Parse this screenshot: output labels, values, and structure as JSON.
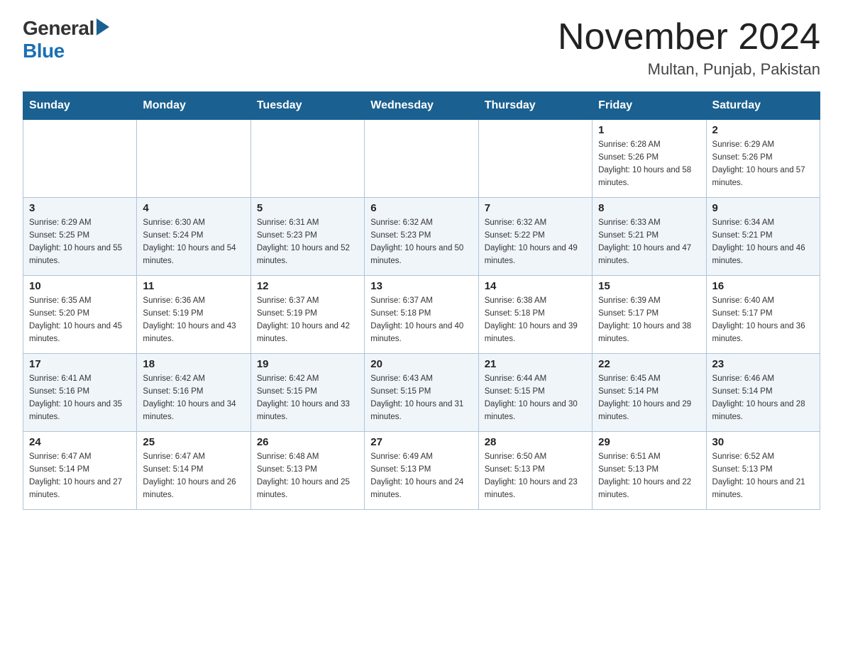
{
  "header": {
    "logo_general": "General",
    "logo_blue": "Blue",
    "month_title": "November 2024",
    "location": "Multan, Punjab, Pakistan"
  },
  "weekdays": [
    "Sunday",
    "Monday",
    "Tuesday",
    "Wednesday",
    "Thursday",
    "Friday",
    "Saturday"
  ],
  "weeks": [
    [
      {
        "day": "",
        "sunrise": "",
        "sunset": "",
        "daylight": ""
      },
      {
        "day": "",
        "sunrise": "",
        "sunset": "",
        "daylight": ""
      },
      {
        "day": "",
        "sunrise": "",
        "sunset": "",
        "daylight": ""
      },
      {
        "day": "",
        "sunrise": "",
        "sunset": "",
        "daylight": ""
      },
      {
        "day": "",
        "sunrise": "",
        "sunset": "",
        "daylight": ""
      },
      {
        "day": "1",
        "sunrise": "Sunrise: 6:28 AM",
        "sunset": "Sunset: 5:26 PM",
        "daylight": "Daylight: 10 hours and 58 minutes."
      },
      {
        "day": "2",
        "sunrise": "Sunrise: 6:29 AM",
        "sunset": "Sunset: 5:26 PM",
        "daylight": "Daylight: 10 hours and 57 minutes."
      }
    ],
    [
      {
        "day": "3",
        "sunrise": "Sunrise: 6:29 AM",
        "sunset": "Sunset: 5:25 PM",
        "daylight": "Daylight: 10 hours and 55 minutes."
      },
      {
        "day": "4",
        "sunrise": "Sunrise: 6:30 AM",
        "sunset": "Sunset: 5:24 PM",
        "daylight": "Daylight: 10 hours and 54 minutes."
      },
      {
        "day": "5",
        "sunrise": "Sunrise: 6:31 AM",
        "sunset": "Sunset: 5:23 PM",
        "daylight": "Daylight: 10 hours and 52 minutes."
      },
      {
        "day": "6",
        "sunrise": "Sunrise: 6:32 AM",
        "sunset": "Sunset: 5:23 PM",
        "daylight": "Daylight: 10 hours and 50 minutes."
      },
      {
        "day": "7",
        "sunrise": "Sunrise: 6:32 AM",
        "sunset": "Sunset: 5:22 PM",
        "daylight": "Daylight: 10 hours and 49 minutes."
      },
      {
        "day": "8",
        "sunrise": "Sunrise: 6:33 AM",
        "sunset": "Sunset: 5:21 PM",
        "daylight": "Daylight: 10 hours and 47 minutes."
      },
      {
        "day": "9",
        "sunrise": "Sunrise: 6:34 AM",
        "sunset": "Sunset: 5:21 PM",
        "daylight": "Daylight: 10 hours and 46 minutes."
      }
    ],
    [
      {
        "day": "10",
        "sunrise": "Sunrise: 6:35 AM",
        "sunset": "Sunset: 5:20 PM",
        "daylight": "Daylight: 10 hours and 45 minutes."
      },
      {
        "day": "11",
        "sunrise": "Sunrise: 6:36 AM",
        "sunset": "Sunset: 5:19 PM",
        "daylight": "Daylight: 10 hours and 43 minutes."
      },
      {
        "day": "12",
        "sunrise": "Sunrise: 6:37 AM",
        "sunset": "Sunset: 5:19 PM",
        "daylight": "Daylight: 10 hours and 42 minutes."
      },
      {
        "day": "13",
        "sunrise": "Sunrise: 6:37 AM",
        "sunset": "Sunset: 5:18 PM",
        "daylight": "Daylight: 10 hours and 40 minutes."
      },
      {
        "day": "14",
        "sunrise": "Sunrise: 6:38 AM",
        "sunset": "Sunset: 5:18 PM",
        "daylight": "Daylight: 10 hours and 39 minutes."
      },
      {
        "day": "15",
        "sunrise": "Sunrise: 6:39 AM",
        "sunset": "Sunset: 5:17 PM",
        "daylight": "Daylight: 10 hours and 38 minutes."
      },
      {
        "day": "16",
        "sunrise": "Sunrise: 6:40 AM",
        "sunset": "Sunset: 5:17 PM",
        "daylight": "Daylight: 10 hours and 36 minutes."
      }
    ],
    [
      {
        "day": "17",
        "sunrise": "Sunrise: 6:41 AM",
        "sunset": "Sunset: 5:16 PM",
        "daylight": "Daylight: 10 hours and 35 minutes."
      },
      {
        "day": "18",
        "sunrise": "Sunrise: 6:42 AM",
        "sunset": "Sunset: 5:16 PM",
        "daylight": "Daylight: 10 hours and 34 minutes."
      },
      {
        "day": "19",
        "sunrise": "Sunrise: 6:42 AM",
        "sunset": "Sunset: 5:15 PM",
        "daylight": "Daylight: 10 hours and 33 minutes."
      },
      {
        "day": "20",
        "sunrise": "Sunrise: 6:43 AM",
        "sunset": "Sunset: 5:15 PM",
        "daylight": "Daylight: 10 hours and 31 minutes."
      },
      {
        "day": "21",
        "sunrise": "Sunrise: 6:44 AM",
        "sunset": "Sunset: 5:15 PM",
        "daylight": "Daylight: 10 hours and 30 minutes."
      },
      {
        "day": "22",
        "sunrise": "Sunrise: 6:45 AM",
        "sunset": "Sunset: 5:14 PM",
        "daylight": "Daylight: 10 hours and 29 minutes."
      },
      {
        "day": "23",
        "sunrise": "Sunrise: 6:46 AM",
        "sunset": "Sunset: 5:14 PM",
        "daylight": "Daylight: 10 hours and 28 minutes."
      }
    ],
    [
      {
        "day": "24",
        "sunrise": "Sunrise: 6:47 AM",
        "sunset": "Sunset: 5:14 PM",
        "daylight": "Daylight: 10 hours and 27 minutes."
      },
      {
        "day": "25",
        "sunrise": "Sunrise: 6:47 AM",
        "sunset": "Sunset: 5:14 PM",
        "daylight": "Daylight: 10 hours and 26 minutes."
      },
      {
        "day": "26",
        "sunrise": "Sunrise: 6:48 AM",
        "sunset": "Sunset: 5:13 PM",
        "daylight": "Daylight: 10 hours and 25 minutes."
      },
      {
        "day": "27",
        "sunrise": "Sunrise: 6:49 AM",
        "sunset": "Sunset: 5:13 PM",
        "daylight": "Daylight: 10 hours and 24 minutes."
      },
      {
        "day": "28",
        "sunrise": "Sunrise: 6:50 AM",
        "sunset": "Sunset: 5:13 PM",
        "daylight": "Daylight: 10 hours and 23 minutes."
      },
      {
        "day": "29",
        "sunrise": "Sunrise: 6:51 AM",
        "sunset": "Sunset: 5:13 PM",
        "daylight": "Daylight: 10 hours and 22 minutes."
      },
      {
        "day": "30",
        "sunrise": "Sunrise: 6:52 AM",
        "sunset": "Sunset: 5:13 PM",
        "daylight": "Daylight: 10 hours and 21 minutes."
      }
    ]
  ]
}
